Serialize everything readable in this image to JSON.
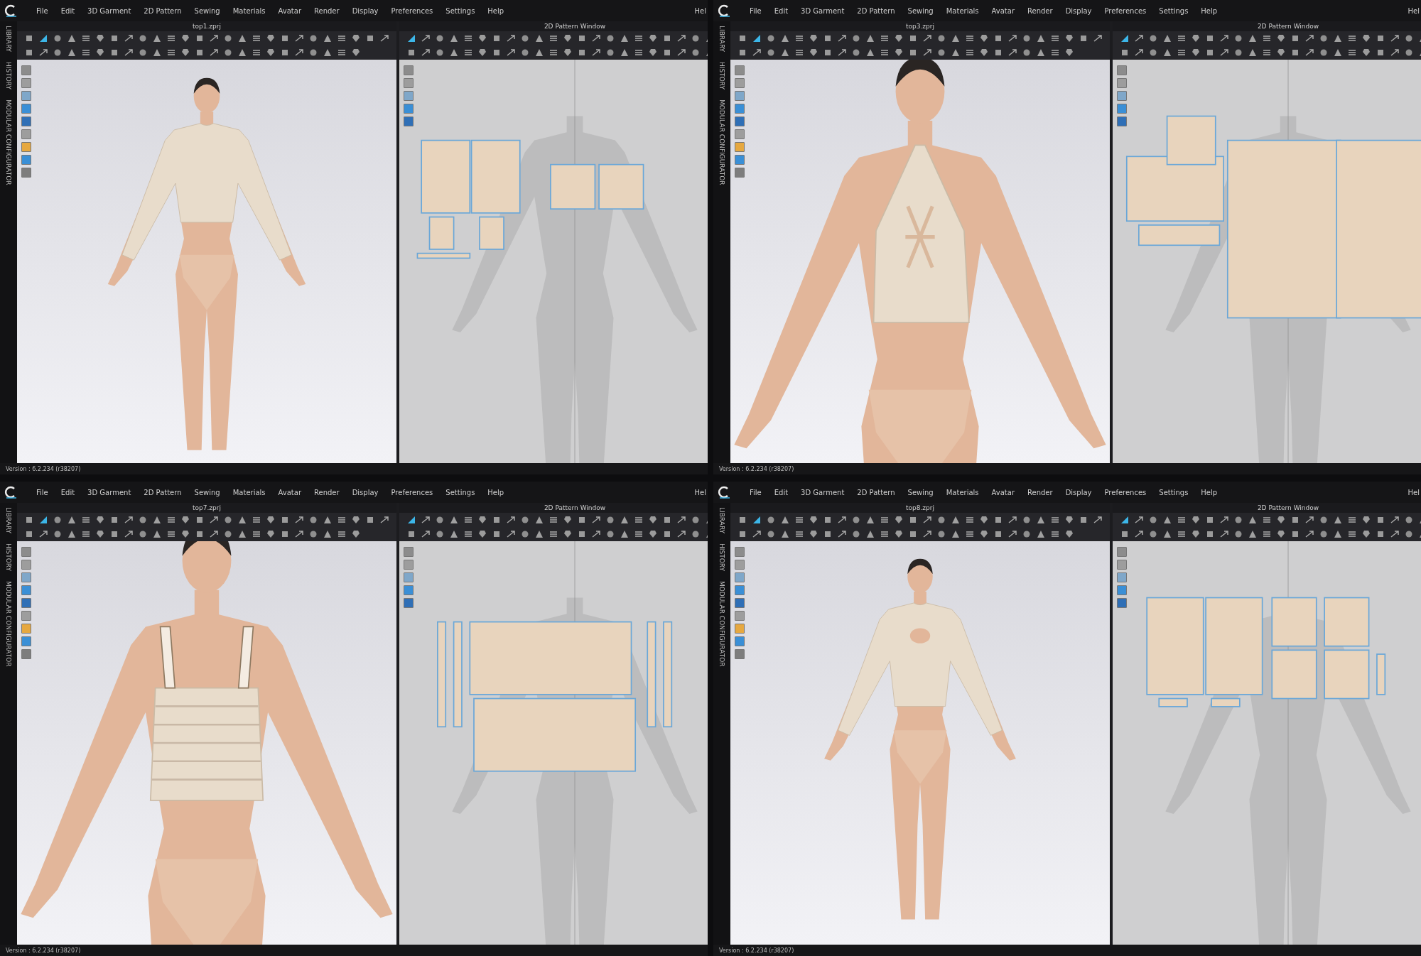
{
  "quadrants": [
    {
      "menu": [
        "File",
        "Edit",
        "3D Garment",
        "2D Pattern",
        "Sewing",
        "Materials",
        "Avatar",
        "Render",
        "Display",
        "Preferences",
        "Settings",
        "Help"
      ],
      "edge_label": "Hel",
      "file": "top1.zprj",
      "pattern_title": "2D Pattern Window",
      "side_tabs": [
        "LIBRARY",
        "HISTORY",
        "MODULAR CONFIGURATOR"
      ],
      "version": "Version : 6.2.234 (r38207)",
      "garment": {
        "kind": "sleeved-top"
      }
    },
    {
      "menu": [
        "File",
        "Edit",
        "3D Garment",
        "2D Pattern",
        "Sewing",
        "Materials",
        "Avatar",
        "Render",
        "Display",
        "Preferences",
        "Settings",
        "Help"
      ],
      "edge_label": "Hel",
      "file": "top3.zprj",
      "pattern_title": "2D Pattern Window",
      "side_tabs": [
        "LIBRARY",
        "HISTORY",
        "MODULAR CONFIGURATOR"
      ],
      "version": "Version : 6.2.234 (r38207)",
      "garment": {
        "kind": "halter-top"
      }
    },
    {
      "menu": [
        "File",
        "Edit",
        "3D Garment",
        "2D Pattern",
        "Sewing",
        "Materials",
        "Avatar",
        "Render",
        "Display",
        "Preferences",
        "Settings",
        "Help"
      ],
      "edge_label": "Hel",
      "file": "top7.zprj",
      "pattern_title": "2D Pattern Window",
      "side_tabs": [
        "LIBRARY",
        "HISTORY",
        "MODULAR CONFIGURATOR"
      ],
      "version": "Version : 6.2.234 (r38207)",
      "garment": {
        "kind": "smocked-top"
      }
    },
    {
      "menu": [
        "File",
        "Edit",
        "3D Garment",
        "2D Pattern",
        "Sewing",
        "Materials",
        "Avatar",
        "Render",
        "Display",
        "Preferences",
        "Settings",
        "Help"
      ],
      "edge_label": "Hel",
      "file": "top8.zprj",
      "pattern_title": "2D Pattern Window",
      "side_tabs": [
        "LIBRARY",
        "HISTORY",
        "MODULAR CONFIGURATOR"
      ],
      "version": "Version : 6.2.234 (r38207)",
      "garment": {
        "kind": "cutout-top"
      }
    }
  ]
}
